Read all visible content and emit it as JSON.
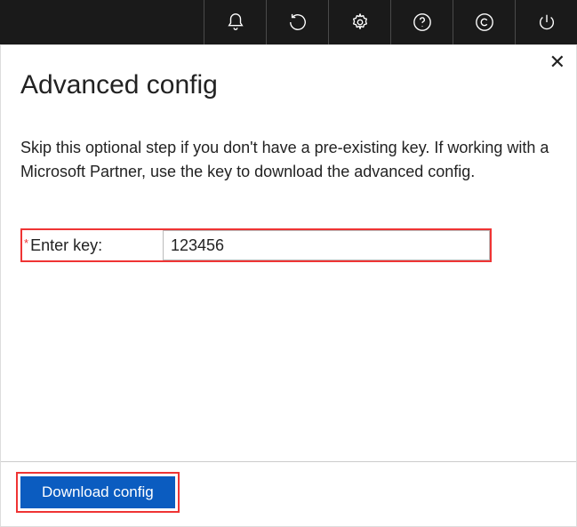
{
  "topbar": {
    "icons": [
      {
        "name": "bell-icon"
      },
      {
        "name": "refresh-icon"
      },
      {
        "name": "gear-icon"
      },
      {
        "name": "help-icon"
      },
      {
        "name": "copyright-icon"
      },
      {
        "name": "power-icon"
      }
    ]
  },
  "dialog": {
    "close_label": "✕",
    "title": "Advanced config",
    "description": "Skip this optional step if you don't have a pre-existing key. If working with a Microsoft Partner, use the key to download the advanced config.",
    "field": {
      "required_mark": "*",
      "label": "Enter key:",
      "value": "123456"
    },
    "download_label": "Download config"
  }
}
